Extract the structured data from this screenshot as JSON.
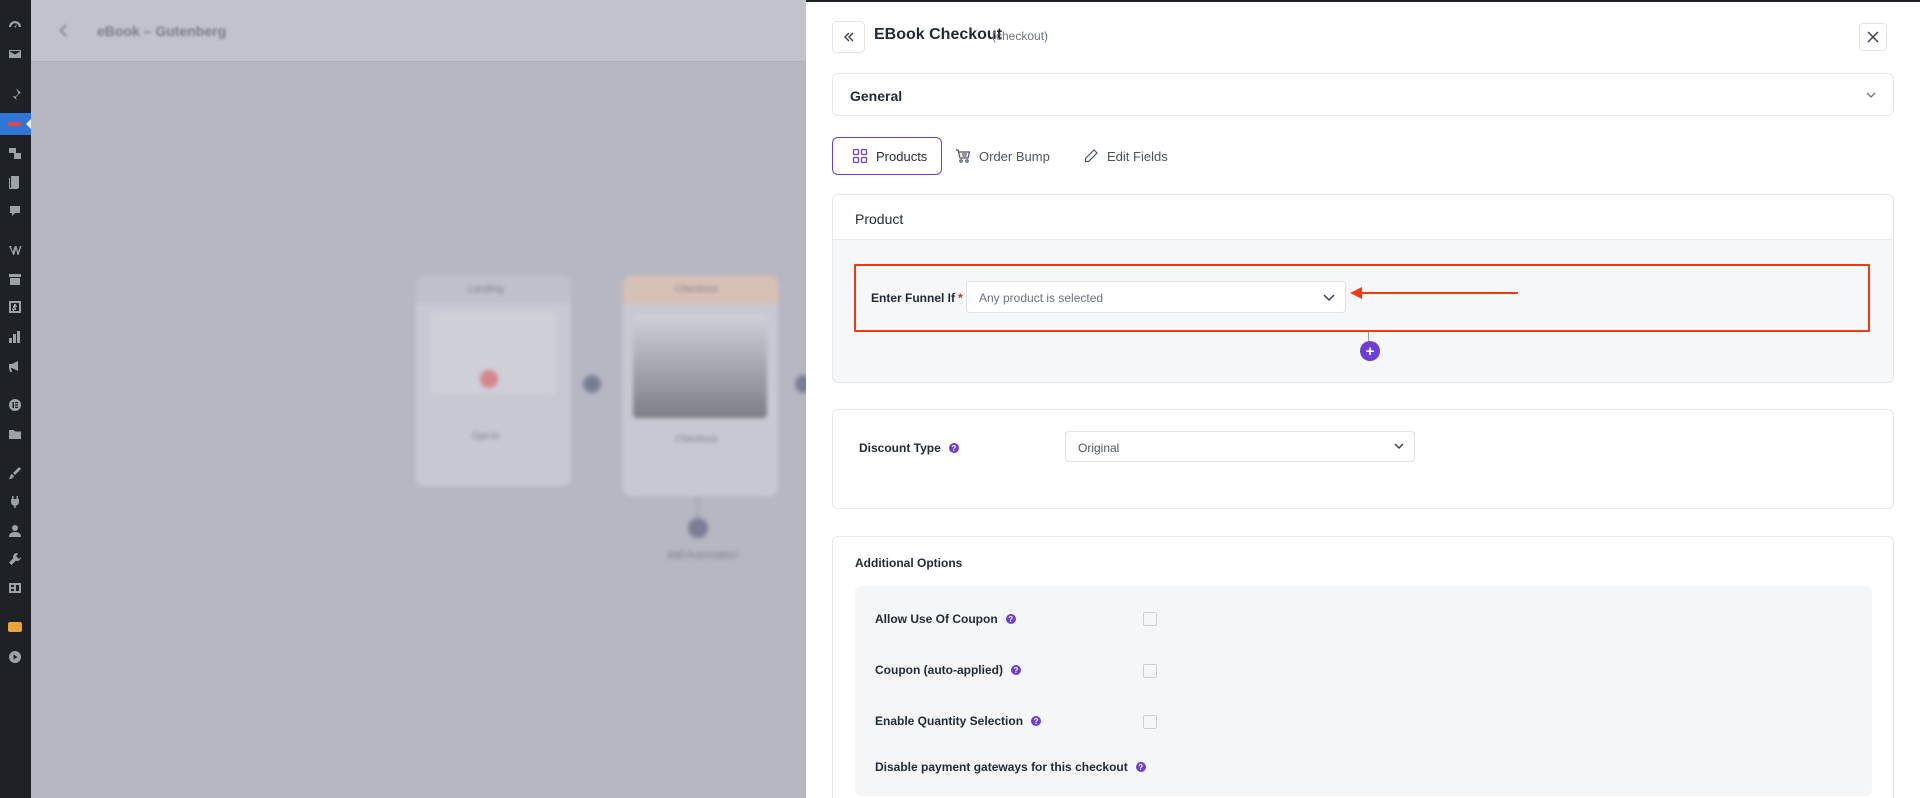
{
  "canvas": {
    "title": "eBook – Gutenberg",
    "nodes": [
      {
        "label": "Landing",
        "footer": "Opt-in"
      },
      {
        "label": "Checkout",
        "footer": "Checkout"
      }
    ],
    "add_automation": "Add Automation"
  },
  "panel": {
    "title": "EBook Checkout",
    "subtitle": "(checkout)",
    "general_label": "General",
    "tabs": [
      {
        "label": "Products",
        "icon": "grid-icon",
        "active": true
      },
      {
        "label": "Order Bump",
        "icon": "cart-icon",
        "active": false
      },
      {
        "label": "Edit Fields",
        "icon": "pencil-icon",
        "active": false
      }
    ],
    "product": {
      "section_title": "Product",
      "funnel_label": "Enter Funnel If",
      "required_mark": "*",
      "funnel_value": "Any product is selected",
      "add_label": "+"
    },
    "discount": {
      "label": "Discount Type",
      "value": "Original"
    },
    "additional": {
      "title": "Additional Options",
      "options": [
        {
          "label": "Allow Use Of Coupon",
          "checked": false
        },
        {
          "label": "Coupon (auto-applied)",
          "checked": false
        },
        {
          "label": "Enable Quantity Selection",
          "checked": false
        },
        {
          "label": "Disable payment gateways for this checkout"
        }
      ]
    }
  },
  "colors": {
    "accent": "#6b3fd4",
    "highlight": "#f5380f",
    "wp_sidebar": "#1e2125",
    "wp_active": "#2f76d6"
  }
}
